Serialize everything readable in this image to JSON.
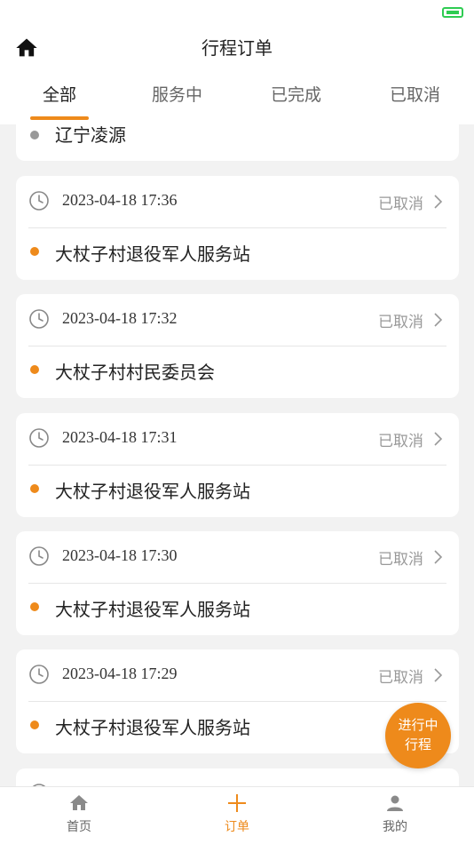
{
  "header": {
    "title": "行程订单"
  },
  "tabs": [
    {
      "label": "全部",
      "active": true
    },
    {
      "label": "服务中",
      "active": false
    },
    {
      "label": "已完成",
      "active": false
    },
    {
      "label": "已取消",
      "active": false
    }
  ],
  "partial_top_card": {
    "place": "辽宁凌源"
  },
  "orders": [
    {
      "time": "2023-04-18 17:36",
      "status": "已取消",
      "place": "大杖子村退役军人服务站"
    },
    {
      "time": "2023-04-18 17:32",
      "status": "已取消",
      "place": "大杖子村村民委员会"
    },
    {
      "time": "2023-04-18 17:31",
      "status": "已取消",
      "place": "大杖子村退役军人服务站"
    },
    {
      "time": "2023-04-18 17:30",
      "status": "已取消",
      "place": "大杖子村退役军人服务站"
    },
    {
      "time": "2023-04-18 17:29",
      "status": "已取消",
      "place": "大杖子村退役军人服务站"
    }
  ],
  "fab": {
    "line1": "进行中",
    "line2": "行程"
  },
  "bottom_nav": [
    {
      "label": "首页",
      "icon": "home-icon",
      "active": false
    },
    {
      "label": "订单",
      "icon": "plus-icon",
      "active": true
    },
    {
      "label": "我的",
      "icon": "user-icon",
      "active": false
    }
  ],
  "colors": {
    "accent": "#ee8a1b",
    "background": "#f2f2f2",
    "muted_dot": "#999999"
  }
}
